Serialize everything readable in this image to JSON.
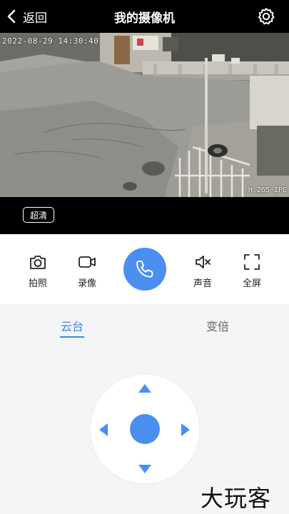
{
  "header": {
    "back_label": "返回",
    "title": "我的摄像机",
    "back_icon": "chevron-left-icon",
    "settings_icon": "gear-icon"
  },
  "video": {
    "timestamp": "2022-08-29 14:30:40",
    "codec": "H.265 IPC",
    "quality_label": "超清"
  },
  "actions": {
    "snapshot": {
      "label": "拍照",
      "icon": "camera-icon"
    },
    "record": {
      "label": "录像",
      "icon": "video-camera-icon"
    },
    "call": {
      "icon": "phone-icon"
    },
    "sound": {
      "label": "声音",
      "icon": "speaker-muted-icon"
    },
    "fullscreen": {
      "label": "全屏",
      "icon": "fullscreen-icon"
    }
  },
  "tabs": {
    "ptz": "云台",
    "zoom": "变倍",
    "active": "云台"
  },
  "colors": {
    "accent": "#4a8ff0",
    "tab_active": "#3a86e8",
    "background": "#f4f5f7",
    "header": "#000000"
  },
  "watermark": "大玩客"
}
